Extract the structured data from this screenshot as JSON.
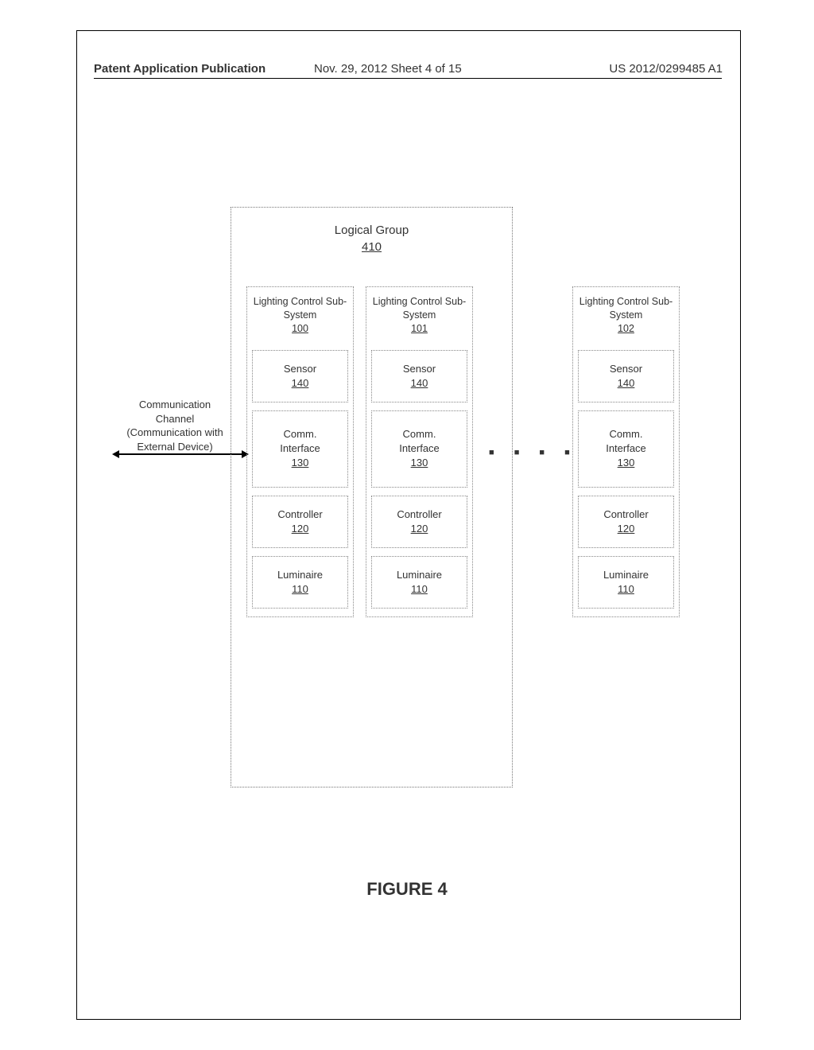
{
  "header": {
    "left": "Patent Application Publication",
    "center": "Nov. 29, 2012  Sheet 4 of 15",
    "right": "US 2012/0299485 A1"
  },
  "comm": {
    "line1": "Communication",
    "line2": "Channel",
    "line3": "(Communication with",
    "line4": "External Device)"
  },
  "group": {
    "title": "Logical Group",
    "ref": "410"
  },
  "subsystems": [
    {
      "head": "Lighting Control Sub-System",
      "ref": "100"
    },
    {
      "head": "Lighting Control Sub-System",
      "ref": "101"
    },
    {
      "head": "Lighting Control Sub-System",
      "ref": "102"
    }
  ],
  "units": {
    "sensor": {
      "label": "Sensor",
      "ref": "140"
    },
    "comm": {
      "label1": "Comm.",
      "label2": "Interface",
      "ref": "130"
    },
    "ctrl": {
      "label": "Controller",
      "ref": "120"
    },
    "lum": {
      "label": "Luminaire",
      "ref": "110"
    }
  },
  "ellipsis": "■ ■ ■ ■",
  "figure": "FIGURE 4"
}
